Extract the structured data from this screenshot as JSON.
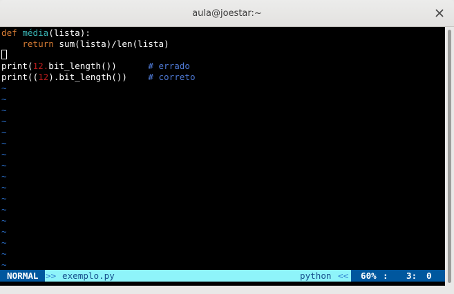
{
  "window": {
    "title": "aula@joestar:~",
    "close_icon": "close-icon"
  },
  "editor": {
    "lines": [
      {
        "parts": [
          {
            "t": "def ",
            "c": "kw"
          },
          {
            "t": "média",
            "c": "fn"
          },
          {
            "t": "(lista):",
            "c": ""
          }
        ]
      },
      {
        "parts": [
          {
            "t": "    ",
            "c": ""
          },
          {
            "t": "return",
            "c": "kw"
          },
          {
            "t": " sum(lista)/len(lista)",
            "c": ""
          }
        ]
      },
      {
        "parts": [],
        "cursor": true
      },
      {
        "parts": [
          {
            "t": "print(",
            "c": ""
          },
          {
            "t": "12.",
            "c": "num"
          },
          {
            "t": "bit_length())      ",
            "c": ""
          },
          {
            "t": "# errado",
            "c": "cm"
          }
        ]
      },
      {
        "parts": [
          {
            "t": "print((",
            "c": ""
          },
          {
            "t": "12",
            "c": "num"
          },
          {
            "t": ").bit_length())    ",
            "c": ""
          },
          {
            "t": "# correto",
            "c": "cm"
          }
        ]
      }
    ],
    "empty_marker": "~",
    "empty_line_count": 17
  },
  "statusline": {
    "mode": "NORMAL",
    "left_separator": ">>",
    "filename": "exemplo.py",
    "filetype": "python",
    "right_separator": "<<",
    "percent": "60%",
    "colon": ":",
    "line": "3:",
    "column": "0"
  },
  "colors": {
    "keyword": "#d57b33",
    "function": "#38b0b0",
    "number": "#b81c1c",
    "comment": "#4e79d4",
    "tilde": "#2b70cc",
    "statusline_bg": "#8ef4fa",
    "mode_bg": "#00579e"
  }
}
